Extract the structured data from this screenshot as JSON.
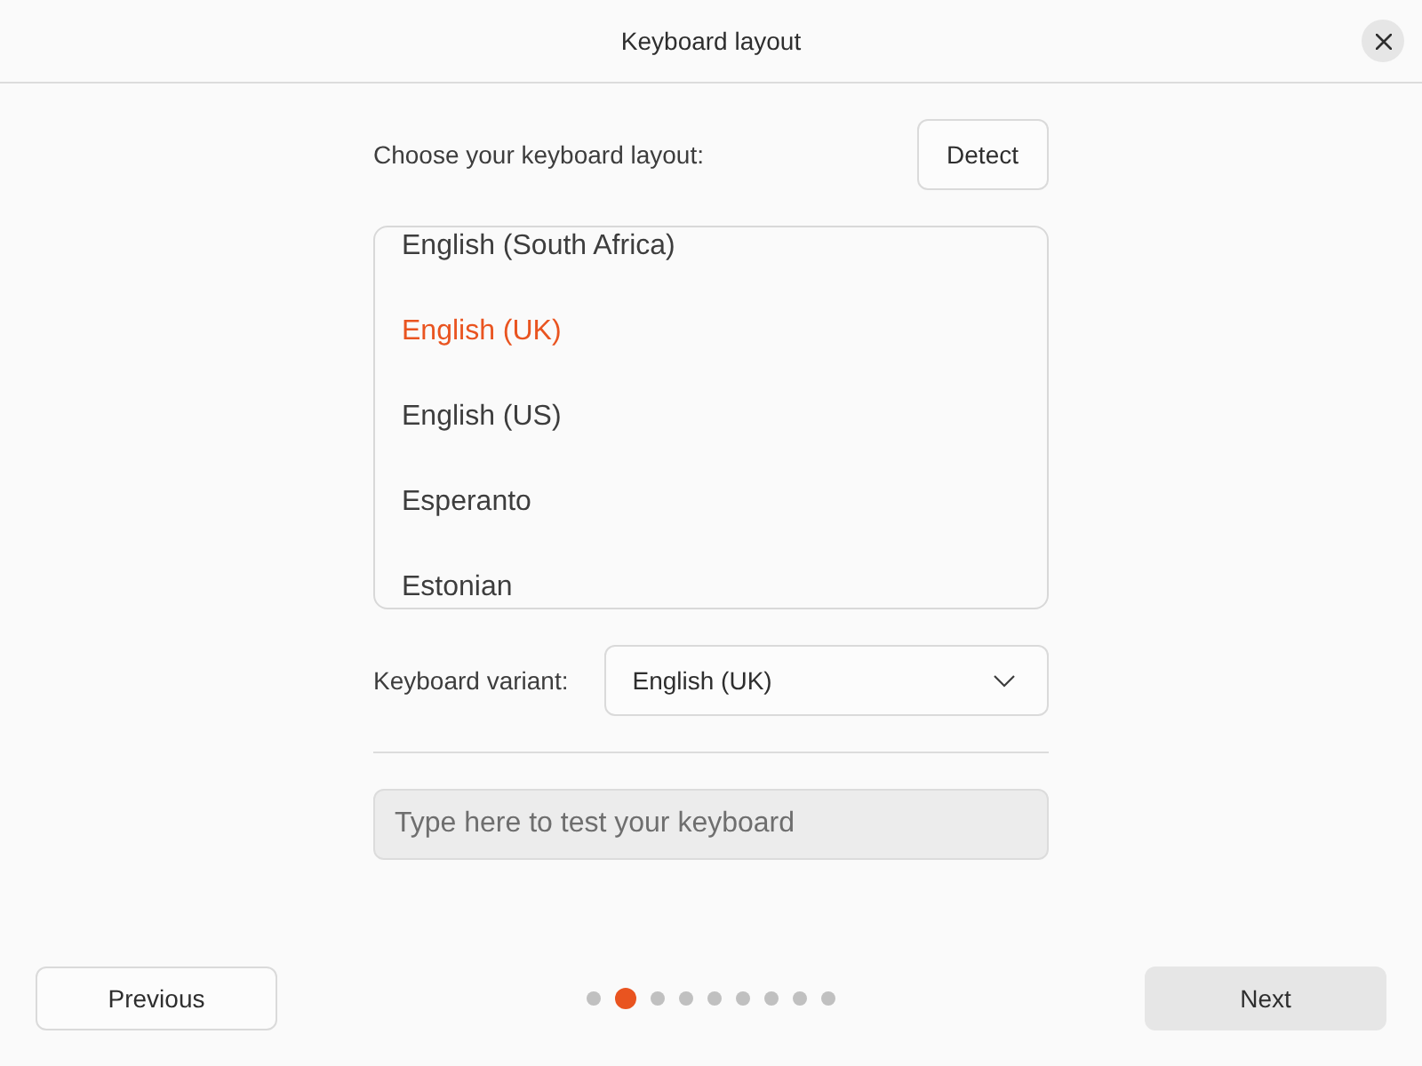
{
  "window": {
    "title": "Keyboard layout"
  },
  "layout_prompt": "Choose your keyboard layout:",
  "detect_button": "Detect",
  "layouts": [
    {
      "label": "English (South Africa)",
      "selected": false
    },
    {
      "label": "English (UK)",
      "selected": true
    },
    {
      "label": "English (US)",
      "selected": false
    },
    {
      "label": "Esperanto",
      "selected": false
    },
    {
      "label": "Estonian",
      "selected": false
    }
  ],
  "variant": {
    "label": "Keyboard variant:",
    "value": "English (UK)"
  },
  "test_field": {
    "placeholder": "Type here to test your keyboard"
  },
  "footer": {
    "previous": "Previous",
    "steps": [
      {
        "selected": false
      },
      {
        "selected": true
      },
      {
        "selected": false
      },
      {
        "selected": false
      },
      {
        "selected": false
      },
      {
        "selected": false
      },
      {
        "selected": false
      },
      {
        "selected": false
      },
      {
        "selected": false
      }
    ],
    "next": "Next"
  }
}
